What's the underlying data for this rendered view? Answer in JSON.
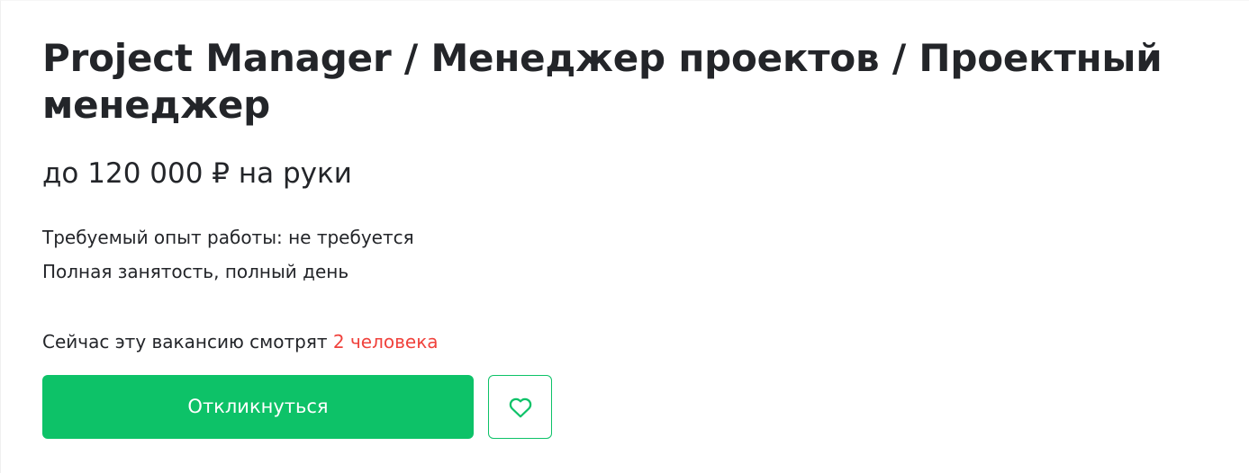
{
  "vacancy": {
    "title": "Project Manager / Менеджер проектов / Проектный менеджер",
    "salary": "до 120 000 ₽ на руки",
    "experience": "Требуемый опыт работы: не требуется",
    "employment": "Полная занятость, полный день",
    "viewers_text": "Сейчас эту вакансию смотрят ",
    "viewers_count": "2 человека"
  },
  "actions": {
    "respond_label": "Откликнуться",
    "favorite_icon": "heart-icon"
  },
  "colors": {
    "accent": "#0dc268",
    "viewers_count": "#f0423c",
    "text": "#232529"
  }
}
